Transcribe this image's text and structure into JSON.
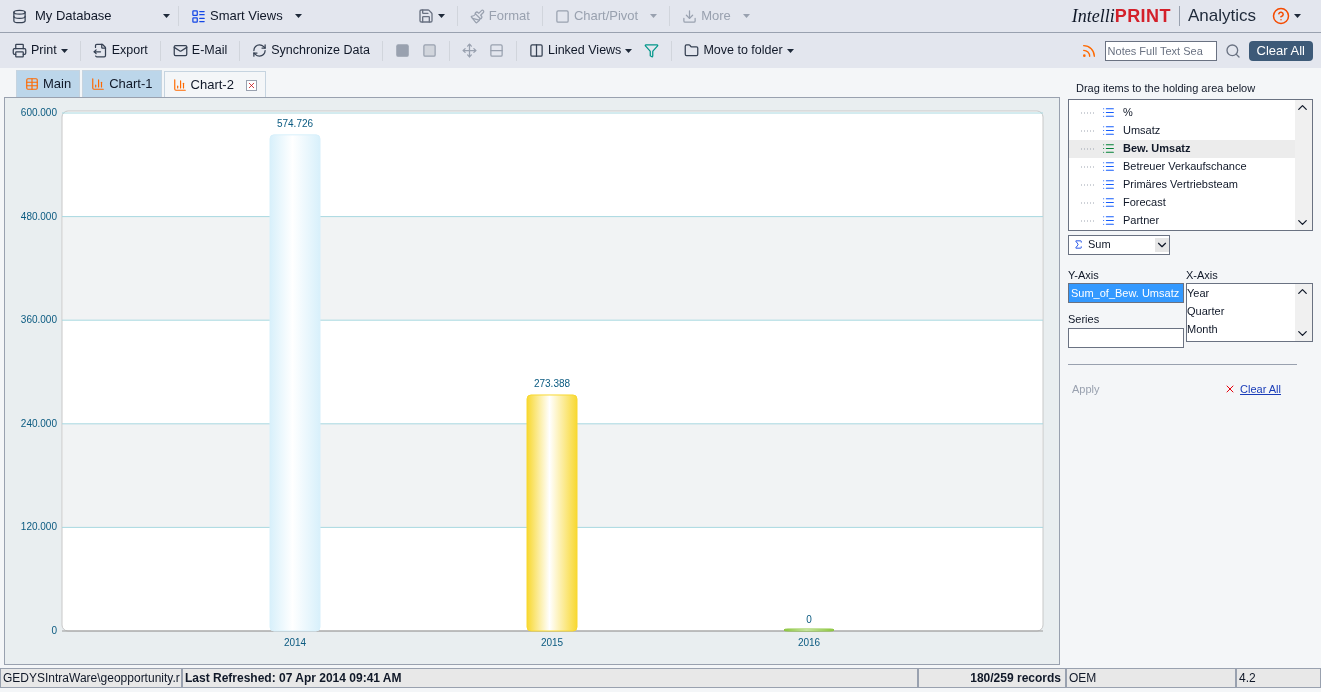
{
  "toolbar": {
    "database": "My Database",
    "items": [
      {
        "label": "Smart Views",
        "disabled": false,
        "kind": "menu"
      },
      {
        "label": "Format",
        "disabled": true,
        "kind": "plain"
      },
      {
        "label": "Chart/Pivot",
        "disabled": true,
        "kind": "menu"
      },
      {
        "label": "More",
        "disabled": true,
        "kind": "menu"
      }
    ]
  },
  "brand": {
    "part_1": "Intelli",
    "part_2": "PRINT",
    "product": "Analytics"
  },
  "actions": [
    {
      "label": "Print",
      "kind": "menu"
    },
    {
      "label": "Export",
      "kind": "plain"
    },
    {
      "label": "E-Mail",
      "kind": "plain"
    },
    {
      "label": "Synchronize Data",
      "kind": "plain"
    },
    {
      "label": "Linked Views",
      "kind": "menu"
    },
    {
      "label": "Move to folder",
      "kind": "menu"
    }
  ],
  "search": {
    "placeholder": "Notes Full Text Sea",
    "button": "Clear All"
  },
  "tabs": [
    {
      "label": "Main",
      "selected": false,
      "kind": "table",
      "closable": false
    },
    {
      "label": "Chart-1",
      "selected": false,
      "kind": "chart",
      "closable": false
    },
    {
      "label": "Chart-2",
      "selected": true,
      "kind": "chart",
      "closable": true
    }
  ],
  "chart_data": {
    "type": "bar",
    "categories": [
      "2014",
      "2015",
      "2016"
    ],
    "series": [
      {
        "color": "#d8f0fb",
        "values": [
          574.726,
          null,
          null
        ]
      },
      {
        "color": "#f8d830",
        "values": [
          null,
          273.388,
          null
        ]
      },
      {
        "color": "#8cc63f",
        "values": [
          null,
          null,
          0
        ]
      }
    ],
    "stacked": true,
    "grid": true,
    "ylim": [
      0,
      600
    ],
    "yticks": [
      {
        "value": 0,
        "label": "0"
      },
      {
        "value": 120,
        "label": "120.000"
      },
      {
        "value": 240,
        "label": "240.000"
      },
      {
        "value": 360,
        "label": "360.000"
      },
      {
        "value": 480,
        "label": "480.000"
      },
      {
        "value": 600,
        "label": "600.000"
      }
    ],
    "value_labels": [
      "574.726",
      "273.388",
      "0"
    ]
  },
  "panel": {
    "hint": "Drag items to the holding area below",
    "fields": [
      {
        "label": "%",
        "selected": false
      },
      {
        "label": "Umsatz",
        "selected": false
      },
      {
        "label": "Bew. Umsatz",
        "selected": true
      },
      {
        "label": "Betreuer Verkaufschance",
        "selected": false
      },
      {
        "label": "Primäres Vertriebsteam",
        "selected": false
      },
      {
        "label": "Forecast",
        "selected": false
      },
      {
        "label": "Partner",
        "selected": false
      }
    ],
    "aggregate": "Sum",
    "y_axis_label": "Y-Axis",
    "y_axis_value": "Sum_of_Bew. Umsatz",
    "series_label": "Series",
    "x_axis_label": "X-Axis",
    "x_axis_items": [
      "Year",
      "Quarter",
      "Month"
    ],
    "apply": {
      "label": "Apply",
      "disabled": true
    },
    "clear": "Clear All"
  },
  "status_bar": {
    "path": "GEDYSIntraWare\\geopportunity.r",
    "refreshed": "Last Refreshed: 07 Apr 2014 09:41 AM",
    "records": "180/259 records",
    "license": "OEM",
    "version": "4.2"
  }
}
